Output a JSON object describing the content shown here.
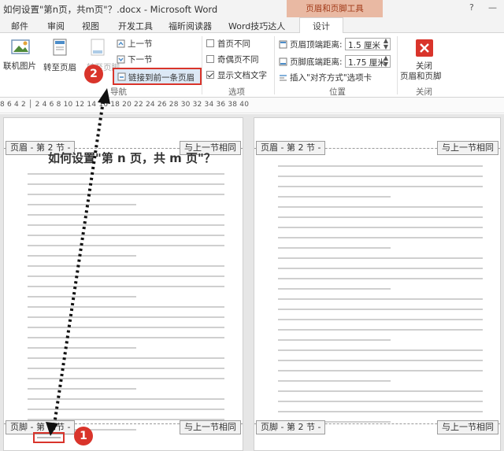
{
  "window": {
    "title": "如何设置\"第n页，共m页\"？.docx - Microsoft Word",
    "contextual_tool": "页眉和页脚工具",
    "help": "?",
    "minimize": "—"
  },
  "tabs": [
    "邮件",
    "审阅",
    "视图",
    "开发工具",
    "福昕阅读器",
    "Word技巧达人",
    "设计"
  ],
  "ribbon": {
    "picture_label": "联机图片",
    "goto_header": "转至页眉",
    "goto_footer": "转至页脚",
    "prev_section": "上一节",
    "next_section": "下一节",
    "link_previous": "链接到前一条页眉",
    "nav_group": "导航",
    "opt_first_page": "首页不同",
    "opt_odd_even": "奇偶页不同",
    "opt_show_text": "显示文档文字",
    "options_group": "选项",
    "header_dist_label": "页眉顶端距离:",
    "header_dist_value": "1.5 厘米",
    "footer_dist_label": "页脚底端距离:",
    "footer_dist_value": "1.75 厘米",
    "insert_align_tab": "插入\"对齐方式\"选项卡",
    "position_group": "位置",
    "close_label_1": "关闭",
    "close_label_2": "页眉和页脚",
    "close_group": "关闭",
    "accent_color": "#d9342b"
  },
  "ruler": {
    "numbers": "8  6  4  2  │  2  4  6  8  10  12  14  16  18  20  22  24  26  28  30  32  34  36  38  40"
  },
  "document": {
    "header_tag": "页眉 - 第 2 节 -",
    "footer_tag": "页脚 - 第 2 节 -",
    "same_as_previous": "与上一节相同",
    "heading": "如何设置\"第 n 页，共 m 页\"？"
  },
  "annotations": {
    "step1": "1",
    "step2": "2"
  }
}
